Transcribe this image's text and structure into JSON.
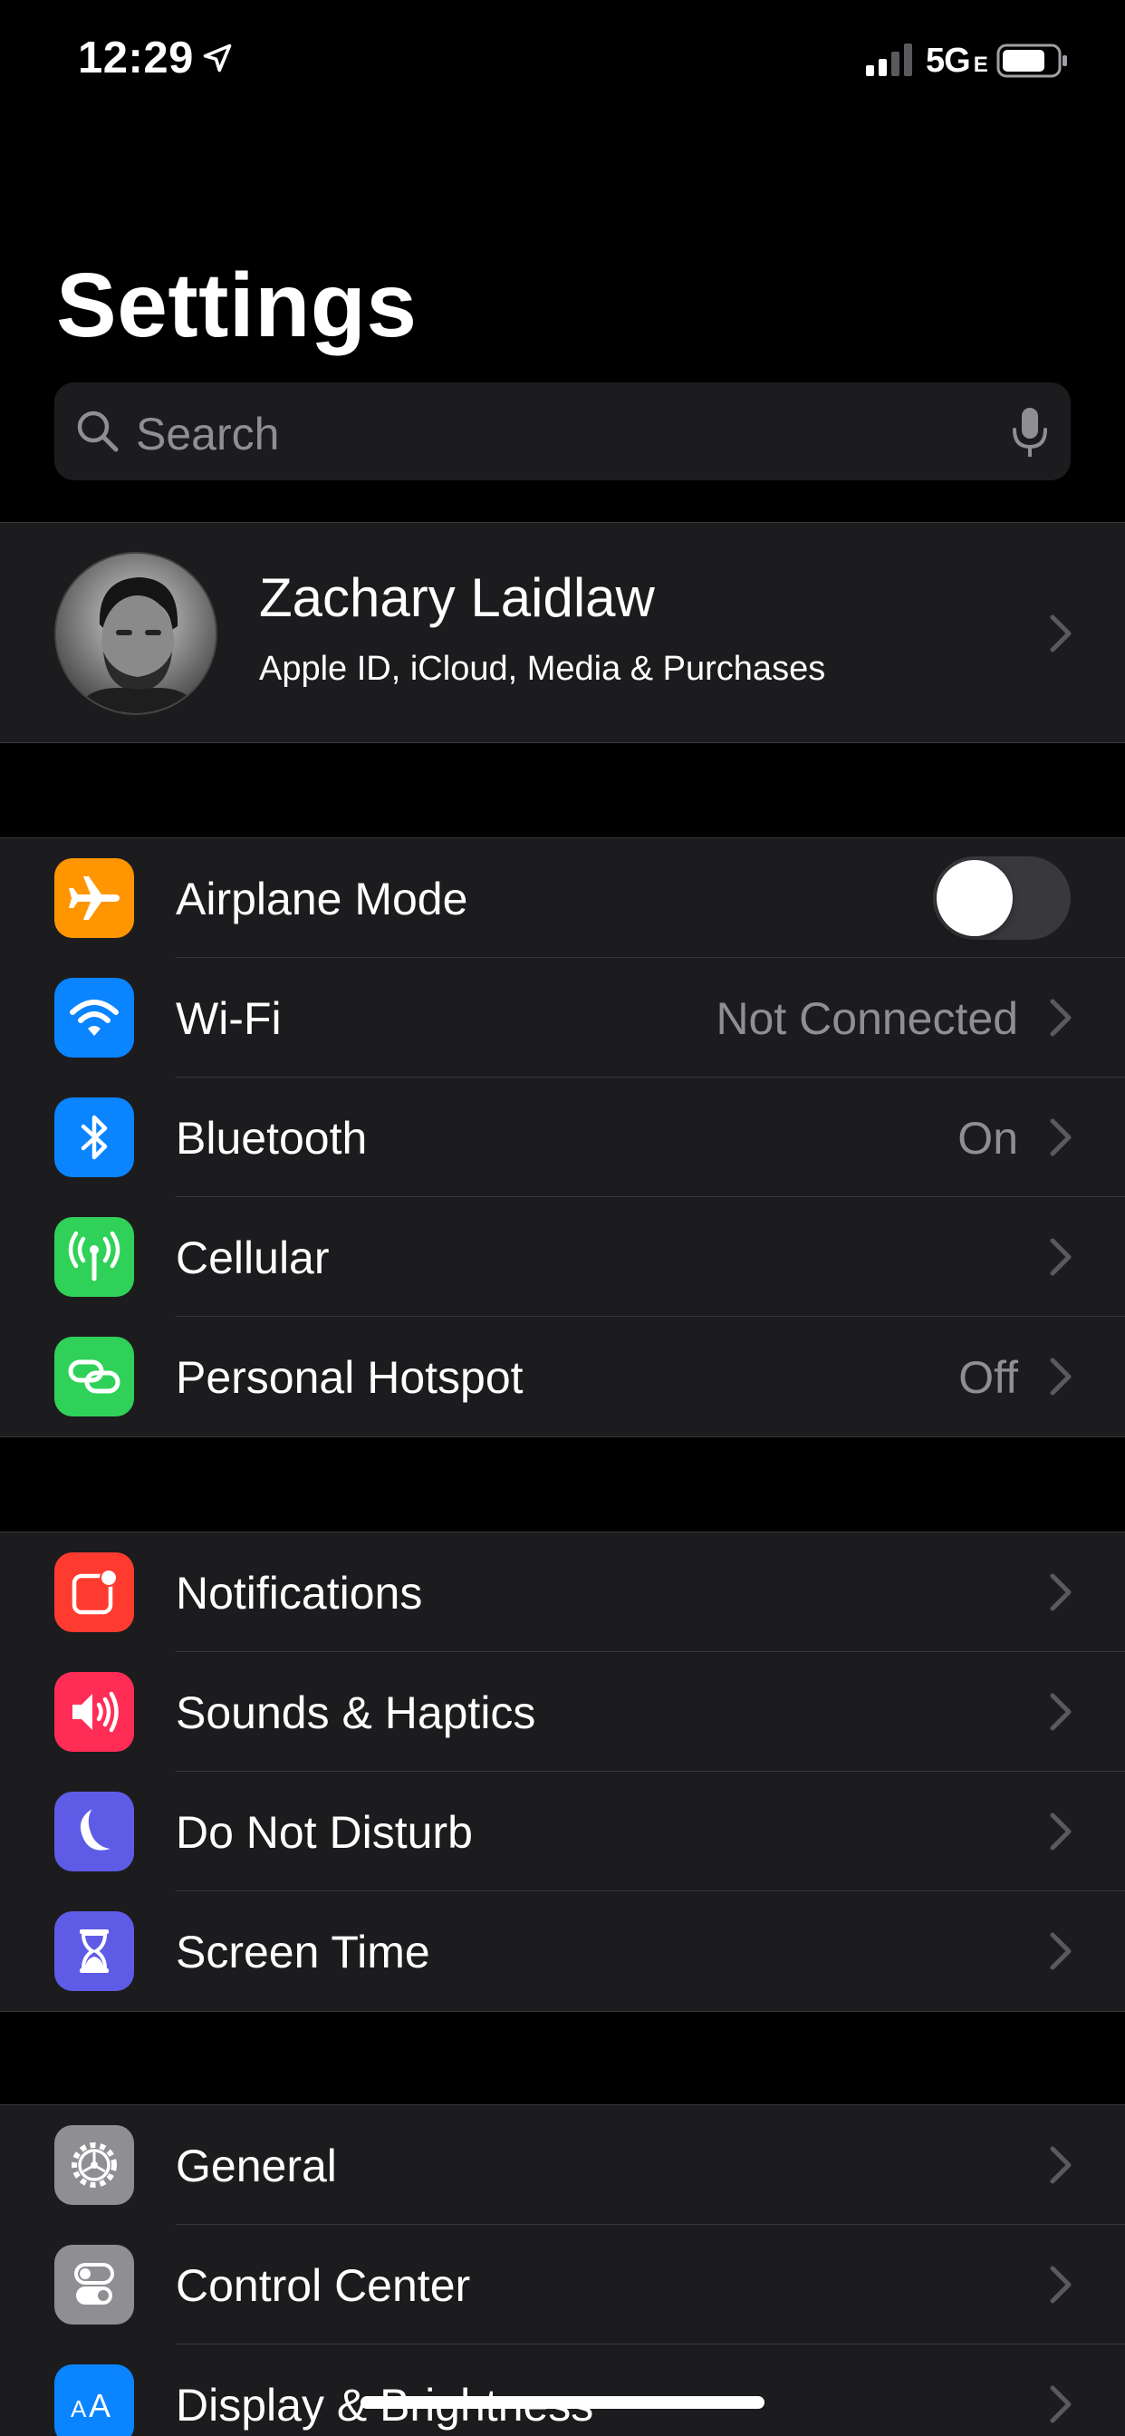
{
  "status_bar": {
    "time": "12:29",
    "network": "5G",
    "network_suffix": "E",
    "icons": [
      "location-arrow-icon",
      "signal-bars-icon",
      "battery-icon"
    ]
  },
  "header": {
    "title": "Settings"
  },
  "search": {
    "placeholder": "Search",
    "icons": [
      "search-icon",
      "microphone-icon"
    ]
  },
  "profile": {
    "name": "Zachary Laidlaw",
    "subtitle": "Apple ID, iCloud, Media & Purchases",
    "avatar": "profile-photo"
  },
  "groups": [
    {
      "rows": [
        {
          "label": "Airplane Mode",
          "icon": "airplane-icon",
          "color": "#ff9500",
          "toggle": false
        },
        {
          "label": "Wi-Fi",
          "value": "Not Connected",
          "icon": "wifi-icon",
          "color": "#0a84ff"
        },
        {
          "label": "Bluetooth",
          "value": "On",
          "icon": "bluetooth-icon",
          "color": "#0a84ff"
        },
        {
          "label": "Cellular",
          "icon": "antenna-icon",
          "color": "#30d158"
        },
        {
          "label": "Personal Hotspot",
          "value": "Off",
          "icon": "hotspot-link-icon",
          "color": "#30d158"
        }
      ]
    },
    {
      "rows": [
        {
          "label": "Notifications",
          "icon": "notification-badge-icon",
          "color": "#ff3b30"
        },
        {
          "label": "Sounds & Haptics",
          "icon": "speaker-icon",
          "color": "#ff2d55"
        },
        {
          "label": "Do Not Disturb",
          "icon": "moon-icon",
          "color": "#5e5ce6"
        },
        {
          "label": "Screen Time",
          "icon": "hourglass-icon",
          "color": "#5e5ce6"
        }
      ]
    },
    {
      "rows": [
        {
          "label": "General",
          "icon": "gear-icon",
          "color": "#8e8e93"
        },
        {
          "label": "Control Center",
          "icon": "switches-icon",
          "color": "#8e8e93"
        },
        {
          "label": "Display & Brightness",
          "icon": "text-size-icon",
          "color": "#0a84ff"
        }
      ]
    }
  ],
  "colors": {
    "background": "#000000",
    "cell": "#1c1c1e",
    "separator": "#38383a",
    "secondary_text": "#8e8e93"
  }
}
